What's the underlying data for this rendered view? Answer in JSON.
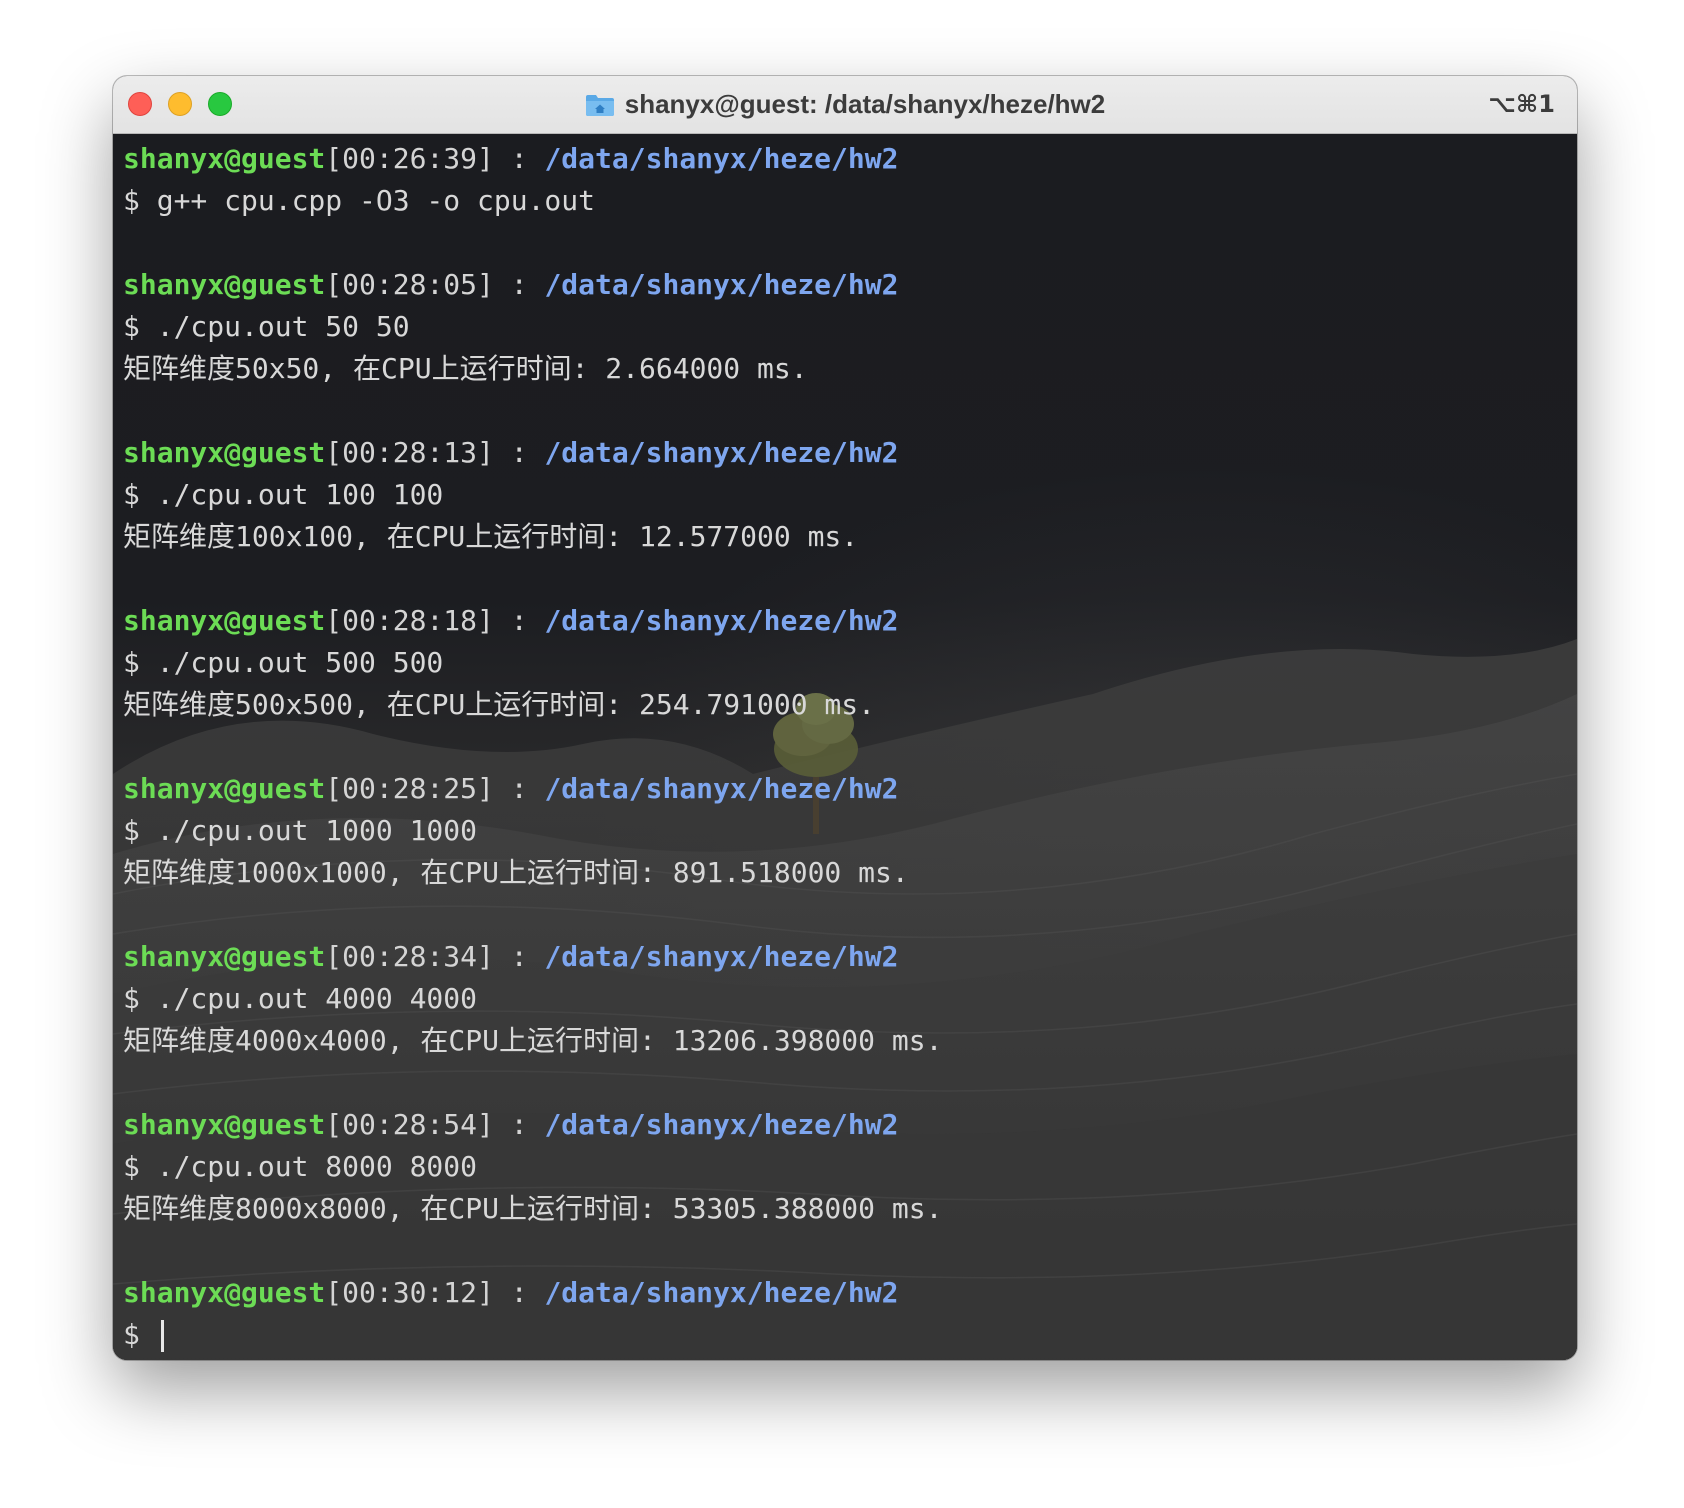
{
  "window": {
    "title": "shanyx@guest: /data/shanyx/heze/hw2",
    "shortcut": "⌥⌘1"
  },
  "colors": {
    "user": "#6cdc55",
    "path": "#7ea6ef",
    "text": "#d8d8d8"
  },
  "terminal": {
    "prompt_user": "shanyx@guest",
    "prompt_path": "/data/shanyx/heze/hw2",
    "prompt_sep": " : ",
    "entries": [
      {
        "time": "[00:26:39]",
        "command": "$ g++ cpu.cpp -O3 -o cpu.out",
        "output": ""
      },
      {
        "time": "[00:28:05]",
        "command": "$ ./cpu.out 50 50",
        "output": "矩阵维度50x50, 在CPU上运行时间: 2.664000 ms."
      },
      {
        "time": "[00:28:13]",
        "command": "$ ./cpu.out 100 100",
        "output": "矩阵维度100x100, 在CPU上运行时间: 12.577000 ms."
      },
      {
        "time": "[00:28:18]",
        "command": "$ ./cpu.out 500 500",
        "output": "矩阵维度500x500, 在CPU上运行时间: 254.791000 ms."
      },
      {
        "time": "[00:28:25]",
        "command": "$ ./cpu.out 1000 1000",
        "output": "矩阵维度1000x1000, 在CPU上运行时间: 891.518000 ms."
      },
      {
        "time": "[00:28:34]",
        "command": "$ ./cpu.out 4000 4000",
        "output": "矩阵维度4000x4000, 在CPU上运行时间: 13206.398000 ms."
      },
      {
        "time": "[00:28:54]",
        "command": "$ ./cpu.out 8000 8000",
        "output": "矩阵维度8000x8000, 在CPU上运行时间: 53305.388000 ms."
      }
    ],
    "final_time": "[00:30:12]",
    "final_prompt": "$ "
  }
}
